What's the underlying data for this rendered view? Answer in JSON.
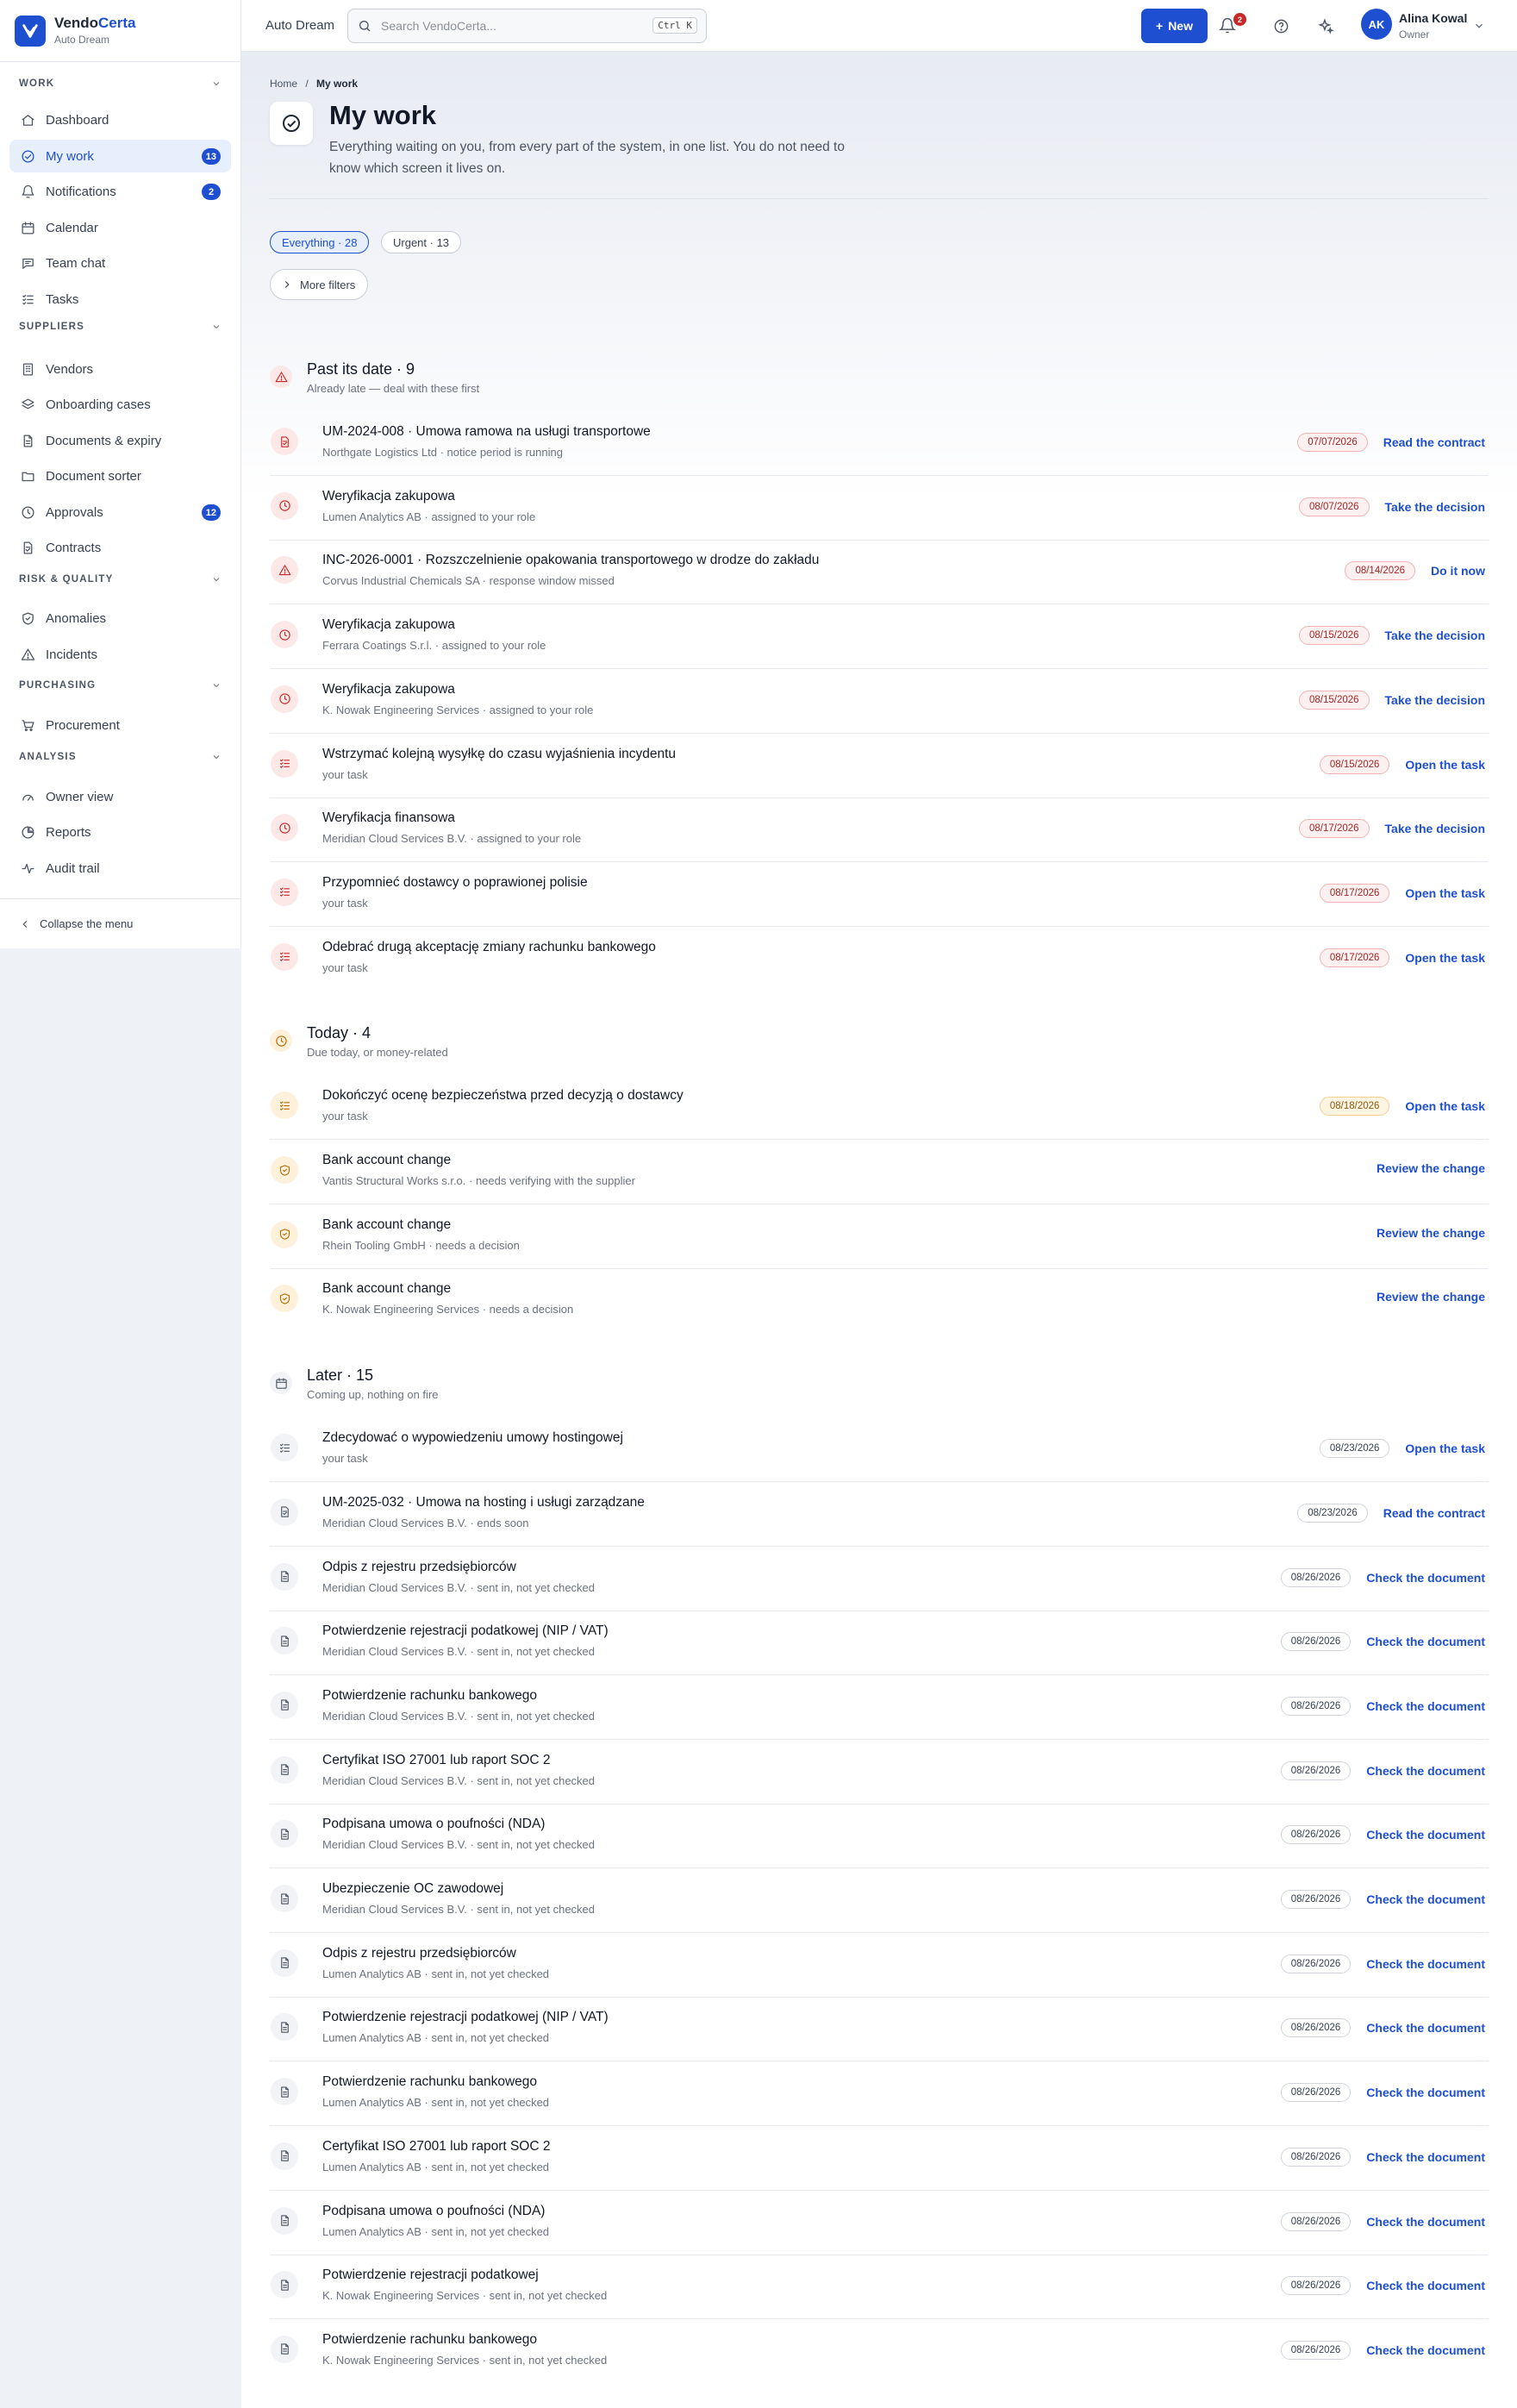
{
  "brand": {
    "name_a": "Vendo",
    "name_b": "Certa",
    "org": "Auto Dream"
  },
  "topbar": {
    "org": "Auto Dream",
    "search_placeholder": "Search VendoCerta...",
    "shortcut": "Ctrl K",
    "new_label": "New",
    "notif_count": "2",
    "user_initials": "AK",
    "user_name": "Alina Kowal",
    "user_role": "Owner"
  },
  "sidebar": {
    "sections": [
      {
        "label": "WORK",
        "items": [
          {
            "label": "Dashboard",
            "icon": "home-icon"
          },
          {
            "label": "My work",
            "icon": "check-circle-icon",
            "count": "13",
            "active": true
          },
          {
            "label": "Notifications",
            "icon": "bell-icon",
            "count": "2"
          },
          {
            "label": "Calendar",
            "icon": "calendar-icon"
          },
          {
            "label": "Team chat",
            "icon": "chat-icon"
          },
          {
            "label": "Tasks",
            "icon": "list-check-icon"
          }
        ]
      },
      {
        "label": "SUPPLIERS",
        "items": [
          {
            "label": "Vendors",
            "icon": "building-icon"
          },
          {
            "label": "Onboarding cases",
            "icon": "layers-icon"
          },
          {
            "label": "Documents & expiry",
            "icon": "file-icon"
          },
          {
            "label": "Document sorter",
            "icon": "folder-icon"
          },
          {
            "label": "Approvals",
            "icon": "clock-icon",
            "count": "12"
          },
          {
            "label": "Contracts",
            "icon": "contract-icon"
          }
        ]
      },
      {
        "label": "RISK & QUALITY",
        "items": [
          {
            "label": "Anomalies",
            "icon": "shield-icon"
          },
          {
            "label": "Incidents",
            "icon": "warning-icon"
          }
        ]
      },
      {
        "label": "PURCHASING",
        "items": [
          {
            "label": "Procurement",
            "icon": "cart-icon"
          }
        ]
      },
      {
        "label": "ANALYSIS",
        "items": [
          {
            "label": "Owner view",
            "icon": "gauge-icon"
          },
          {
            "label": "Reports",
            "icon": "pie-icon"
          },
          {
            "label": "Audit trail",
            "icon": "activity-icon"
          }
        ]
      }
    ],
    "collapse_label": "Collapse the menu"
  },
  "page": {
    "breadcrumb_home": "Home",
    "breadcrumb_sep": "/",
    "breadcrumb_current": "My work",
    "title": "My work",
    "description": "Everything waiting on you, from every part of the system, in one list. You do not need to know which screen it lives on.",
    "chips": [
      "Everything · 28",
      "Urgent · 13"
    ],
    "more_filters": "More filters"
  },
  "groups": [
    {
      "title": "Past its date · 9",
      "subtitle": "Already late — deal with these first",
      "tone": "red",
      "icon": "warning-icon",
      "items": [
        {
          "title": "UM-2024-008 · Umowa ramowa na usługi transportowe",
          "sub": "Northgate Logistics Ltd · notice period is running",
          "date": "07/07/2026",
          "action": "Read the contract",
          "icon": "contract-icon"
        },
        {
          "title": "Weryfikacja zakupowa",
          "sub": "Lumen Analytics AB · assigned to your role",
          "date": "08/07/2026",
          "action": "Take the decision",
          "icon": "clock-icon"
        },
        {
          "title": "INC-2026-0001 · Rozszczelnienie opakowania transportowego w drodze do zakładu",
          "sub": "Corvus Industrial Chemicals SA · response window missed",
          "date": "08/14/2026",
          "action": "Do it now",
          "icon": "warning-icon"
        },
        {
          "title": "Weryfikacja zakupowa",
          "sub": "Ferrara Coatings S.r.l. · assigned to your role",
          "date": "08/15/2026",
          "action": "Take the decision",
          "icon": "clock-icon"
        },
        {
          "title": "Weryfikacja zakupowa",
          "sub": "K. Nowak Engineering Services · assigned to your role",
          "date": "08/15/2026",
          "action": "Take the decision",
          "icon": "clock-icon"
        },
        {
          "title": "Wstrzymać kolejną wysyłkę do czasu wyjaśnienia incydentu",
          "sub": "your task",
          "date": "08/15/2026",
          "action": "Open the task",
          "icon": "list-check-icon"
        },
        {
          "title": "Weryfikacja finansowa",
          "sub": "Meridian Cloud Services B.V. · assigned to your role",
          "date": "08/17/2026",
          "action": "Take the decision",
          "icon": "clock-icon"
        },
        {
          "title": "Przypomnieć dostawcy o poprawionej polisie",
          "sub": "your task",
          "date": "08/17/2026",
          "action": "Open the task",
          "icon": "list-check-icon"
        },
        {
          "title": "Odebrać drugą akceptację zmiany rachunku bankowego",
          "sub": "your task",
          "date": "08/17/2026",
          "action": "Open the task",
          "icon": "list-check-icon"
        }
      ]
    },
    {
      "title": "Today · 4",
      "subtitle": "Due today, or money-related",
      "tone": "amber",
      "icon": "clock-icon",
      "items": [
        {
          "title": "Dokończyć ocenę bezpieczeństwa przed decyzją o dostawcy",
          "sub": "your task",
          "date": "08/18/2026",
          "action": "Open the task",
          "icon": "list-check-icon"
        },
        {
          "title": "Bank account change",
          "sub": "Vantis Structural Works s.r.o. · needs verifying with the supplier",
          "date": "",
          "action": "Review the change",
          "icon": "shield-icon"
        },
        {
          "title": "Bank account change",
          "sub": "Rhein Tooling GmbH · needs a decision",
          "date": "",
          "action": "Review the change",
          "icon": "shield-icon"
        },
        {
          "title": "Bank account change",
          "sub": "K. Nowak Engineering Services · needs a decision",
          "date": "",
          "action": "Review the change",
          "icon": "shield-icon"
        }
      ]
    },
    {
      "title": "Later · 15",
      "subtitle": "Coming up, nothing on fire",
      "tone": "gray",
      "icon": "calendar-icon",
      "items": [
        {
          "title": "Zdecydować o wypowiedzeniu umowy hostingowej",
          "sub": "your task",
          "date": "08/23/2026",
          "action": "Open the task",
          "icon": "list-check-icon"
        },
        {
          "title": "UM-2025-032 · Umowa na hosting i usługi zarządzane",
          "sub": "Meridian Cloud Services B.V. · ends soon",
          "date": "08/23/2026",
          "action": "Read the contract",
          "icon": "contract-icon"
        },
        {
          "title": "Odpis z rejestru przedsiębiorców",
          "sub": "Meridian Cloud Services B.V. · sent in, not yet checked",
          "date": "08/26/2026",
          "action": "Check the document",
          "icon": "file-icon"
        },
        {
          "title": "Potwierdzenie rejestracji podatkowej (NIP / VAT)",
          "sub": "Meridian Cloud Services B.V. · sent in, not yet checked",
          "date": "08/26/2026",
          "action": "Check the document",
          "icon": "file-icon"
        },
        {
          "title": "Potwierdzenie rachunku bankowego",
          "sub": "Meridian Cloud Services B.V. · sent in, not yet checked",
          "date": "08/26/2026",
          "action": "Check the document",
          "icon": "file-icon"
        },
        {
          "title": "Certyfikat ISO 27001 lub raport SOC 2",
          "sub": "Meridian Cloud Services B.V. · sent in, not yet checked",
          "date": "08/26/2026",
          "action": "Check the document",
          "icon": "file-icon"
        },
        {
          "title": "Podpisana umowa o poufności (NDA)",
          "sub": "Meridian Cloud Services B.V. · sent in, not yet checked",
          "date": "08/26/2026",
          "action": "Check the document",
          "icon": "file-icon"
        },
        {
          "title": "Ubezpieczenie OC zawodowej",
          "sub": "Meridian Cloud Services B.V. · sent in, not yet checked",
          "date": "08/26/2026",
          "action": "Check the document",
          "icon": "file-icon"
        },
        {
          "title": "Odpis z rejestru przedsiębiorców",
          "sub": "Lumen Analytics AB · sent in, not yet checked",
          "date": "08/26/2026",
          "action": "Check the document",
          "icon": "file-icon"
        },
        {
          "title": "Potwierdzenie rejestracji podatkowej (NIP / VAT)",
          "sub": "Lumen Analytics AB · sent in, not yet checked",
          "date": "08/26/2026",
          "action": "Check the document",
          "icon": "file-icon"
        },
        {
          "title": "Potwierdzenie rachunku bankowego",
          "sub": "Lumen Analytics AB · sent in, not yet checked",
          "date": "08/26/2026",
          "action": "Check the document",
          "icon": "file-icon"
        },
        {
          "title": "Certyfikat ISO 27001 lub raport SOC 2",
          "sub": "Lumen Analytics AB · sent in, not yet checked",
          "date": "08/26/2026",
          "action": "Check the document",
          "icon": "file-icon"
        },
        {
          "title": "Podpisana umowa o poufności (NDA)",
          "sub": "Lumen Analytics AB · sent in, not yet checked",
          "date": "08/26/2026",
          "action": "Check the document",
          "icon": "file-icon"
        },
        {
          "title": "Potwierdzenie rejestracji podatkowej",
          "sub": "K. Nowak Engineering Services · sent in, not yet checked",
          "date": "08/26/2026",
          "action": "Check the document",
          "icon": "file-icon"
        },
        {
          "title": "Potwierdzenie rachunku bankowego",
          "sub": "K. Nowak Engineering Services · sent in, not yet checked",
          "date": "08/26/2026",
          "action": "Check the document",
          "icon": "file-icon"
        }
      ]
    }
  ],
  "colors": {
    "accent": "#1d4fd0",
    "danger": "#c62828",
    "warning": "#b26a00"
  }
}
